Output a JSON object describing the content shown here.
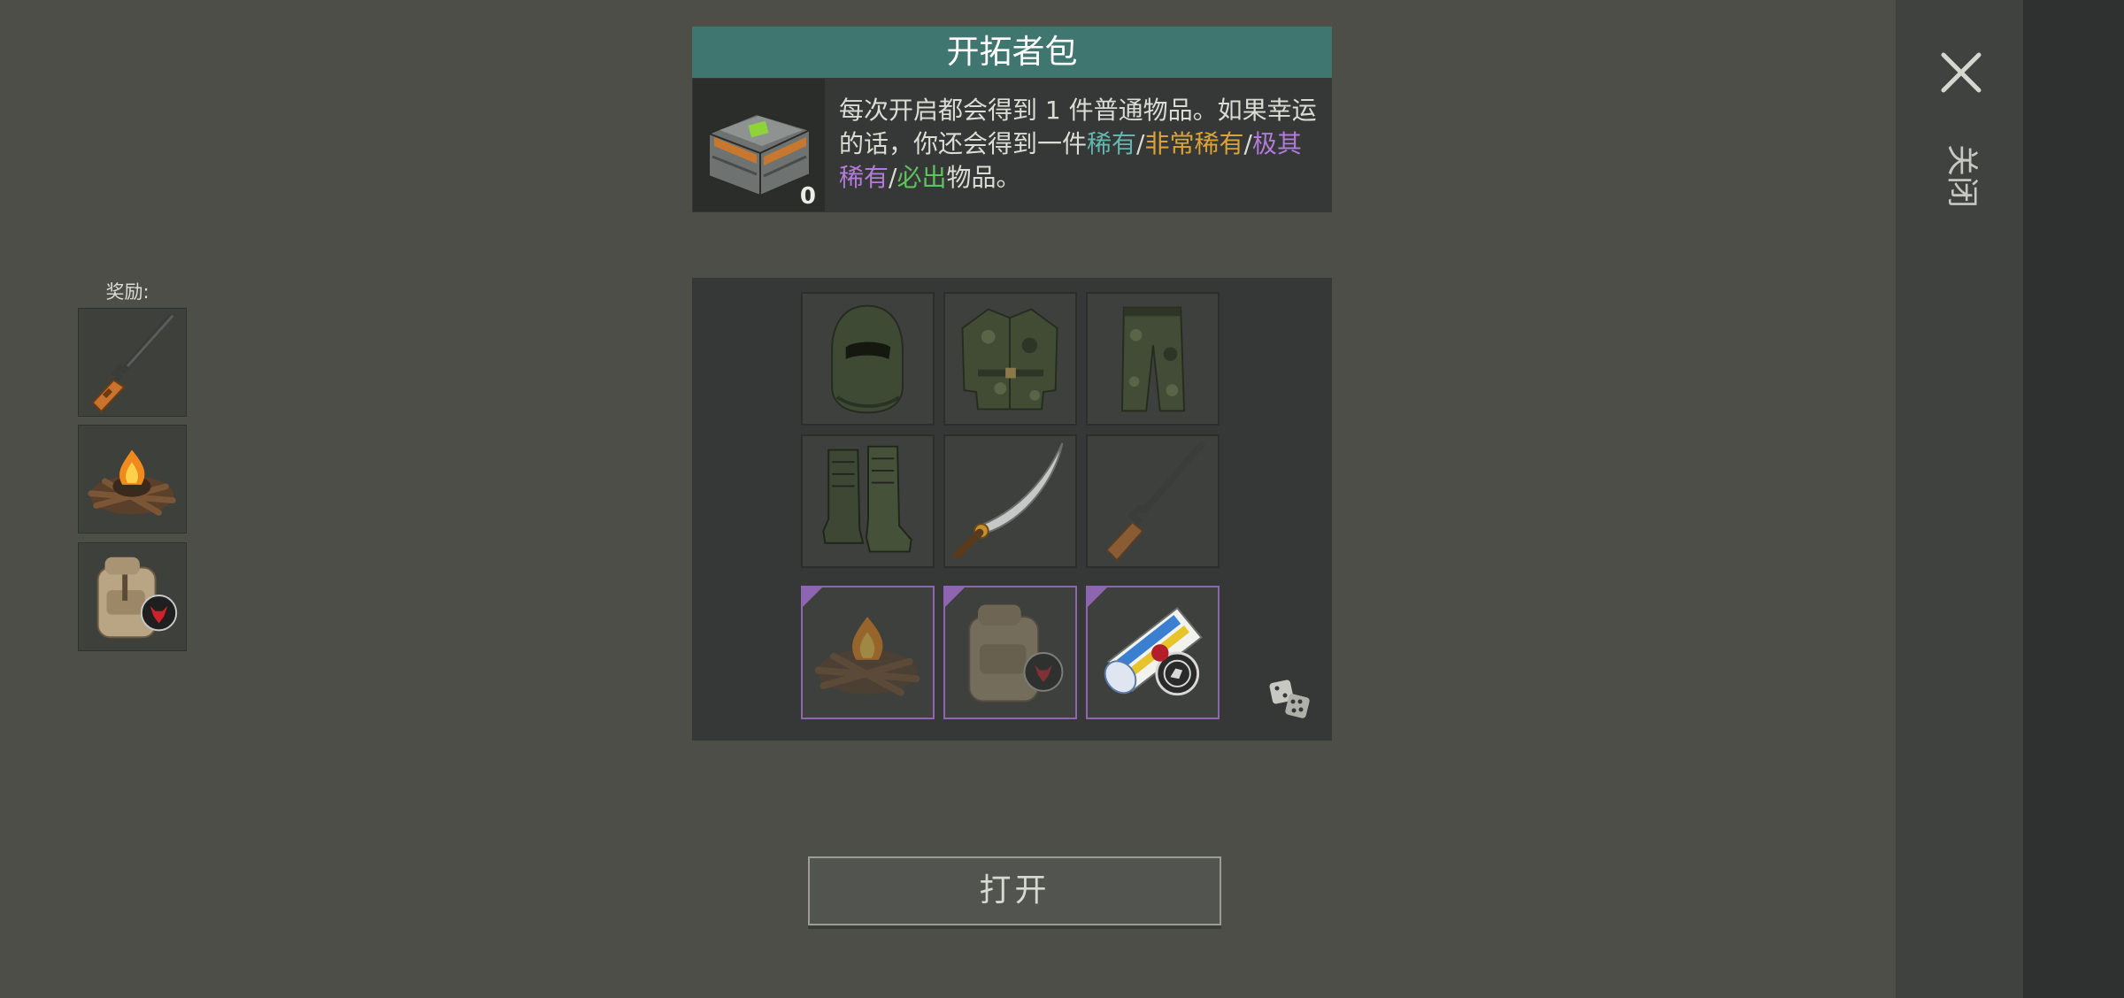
{
  "close": {
    "label": "关闭",
    "icon": "close-x-icon"
  },
  "rewards": {
    "label": "奖励:",
    "items": [
      {
        "name": "rifle",
        "icon": "rifle-icon"
      },
      {
        "name": "campfire",
        "icon": "campfire-icon"
      },
      {
        "name": "backpack",
        "icon": "backpack-icon"
      }
    ]
  },
  "pack": {
    "title": "开拓者包",
    "count": "0",
    "desc": {
      "line_start": "每次开启都会得到 1 件普通物品。如果幸运的话，你还会得到一件",
      "rare": "稀有",
      "sep1": "/",
      "very_rare": "非常稀有",
      "sep2": "/",
      "epic": "极其稀有",
      "sep3": "/",
      "guaranteed": "必出",
      "line_end": "物品。"
    }
  },
  "loot": {
    "items": [
      {
        "name": "balaclava",
        "icon": "balaclava-icon",
        "rarity": "common"
      },
      {
        "name": "camo-jacket",
        "icon": "jacket-icon",
        "rarity": "common"
      },
      {
        "name": "camo-pants",
        "icon": "pants-icon",
        "rarity": "common"
      },
      {
        "name": "boots",
        "icon": "boots-icon",
        "rarity": "common"
      },
      {
        "name": "machete",
        "icon": "machete-icon",
        "rarity": "common"
      },
      {
        "name": "rifle",
        "icon": "rifle-icon",
        "rarity": "common"
      },
      {
        "name": "campfire",
        "icon": "campfire-icon",
        "rarity": "epic"
      },
      {
        "name": "backpack",
        "icon": "backpack-icon",
        "rarity": "epic"
      },
      {
        "name": "scroll-map",
        "icon": "scroll-icon",
        "rarity": "epic"
      }
    ],
    "dice_icon": "dice-icon"
  },
  "open_button": {
    "label": "打开"
  },
  "colors": {
    "header": "#3f7670",
    "rare": "#63b5b0",
    "very_rare": "#dba237",
    "epic": "#b27ad9",
    "guaranteed": "#5fc25c",
    "epic_border": "#8d65b1"
  }
}
